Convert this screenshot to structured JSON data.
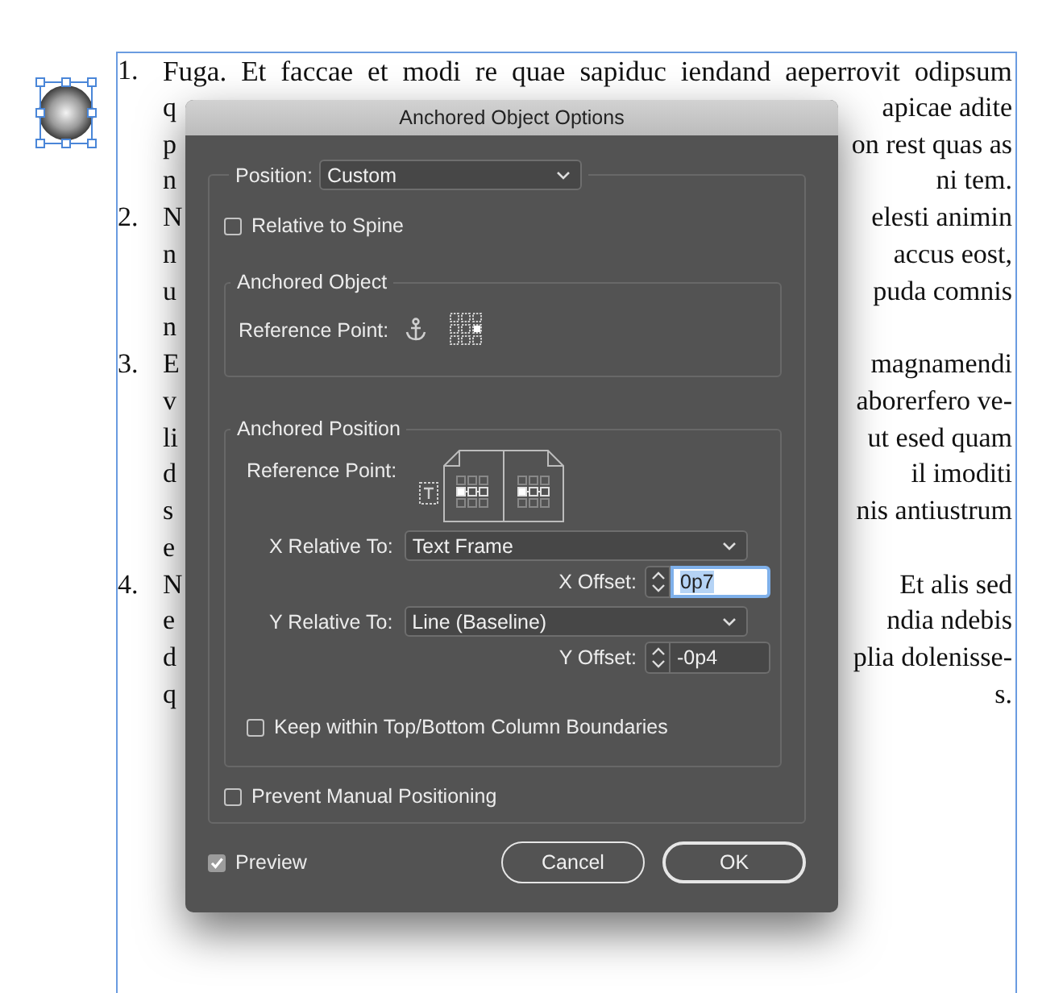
{
  "document": {
    "lines": [
      {
        "number": "1.",
        "left": "Fuga. Et faccae et modi re quae sapiduc iendand aeperrovit odipsum"
      },
      {
        "left": "q",
        "right": "apicae adite"
      },
      {
        "left": "p",
        "right": "on rest quas as"
      },
      {
        "left": "n",
        "right": "ni tem."
      },
      {
        "number": "2.",
        "left": "N",
        "right": "elesti animin"
      },
      {
        "left": "n",
        "right": "accus eost,"
      },
      {
        "left": "u",
        "right": "puda comnis"
      },
      {
        "left": "n"
      },
      {
        "number": "3.",
        "left": "E",
        "right": "magnamendi"
      },
      {
        "left": "v",
        "right": "aborerfero ve-"
      },
      {
        "left": "li",
        "right": "ut esed quam"
      },
      {
        "left": "d",
        "right": "il imoditi"
      },
      {
        "left": "s",
        "right": "nis antiustrum"
      },
      {
        "left": "e"
      },
      {
        "number": "4.",
        "left": "N",
        "right": "Et alis sed"
      },
      {
        "left": "e",
        "right": "ndia ndebis"
      },
      {
        "left": "d",
        "right": "plia dolenisse-"
      },
      {
        "left": "q",
        "right": "s."
      }
    ]
  },
  "dialog": {
    "title": "Anchored Object Options",
    "position": {
      "label": "Position:",
      "value": "Custom"
    },
    "relative_to_spine": {
      "label": "Relative to Spine",
      "checked": false
    },
    "anchored_object": {
      "title": "Anchored Object",
      "reference_point_label": "Reference Point:"
    },
    "anchored_position": {
      "title": "Anchored Position",
      "reference_point_label": "Reference Point:",
      "x_relative_to": {
        "label": "X Relative To:",
        "value": "Text Frame"
      },
      "x_offset": {
        "label": "X Offset:",
        "value": "0p7",
        "focused": true
      },
      "y_relative_to": {
        "label": "Y Relative To:",
        "value": "Line (Baseline)"
      },
      "y_offset": {
        "label": "Y Offset:",
        "value": "-0p4",
        "focused": false
      },
      "keep_within_boundaries": {
        "label": "Keep within Top/Bottom Column Boundaries",
        "checked": false
      }
    },
    "prevent_manual_positioning": {
      "label": "Prevent Manual Positioning",
      "checked": false
    },
    "preview": {
      "label": "Preview",
      "checked": true
    },
    "buttons": [
      {
        "label": "Cancel",
        "default": false
      },
      {
        "label": "OK",
        "default": true
      }
    ]
  }
}
